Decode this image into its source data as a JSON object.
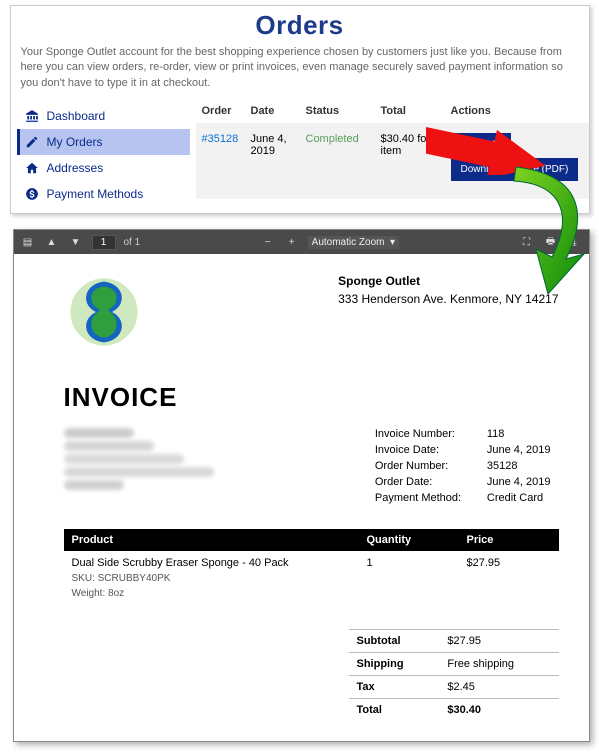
{
  "header": {
    "title": "Orders",
    "description": "Your Sponge Outlet account for the best shopping experience chosen by customers just like you. Because from here you can view orders, re-order, view or print invoices, even manage securely saved payment information so you don't have to type it in at checkout."
  },
  "sidebar": {
    "items": [
      {
        "label": "Dashboard"
      },
      {
        "label": "My Orders"
      },
      {
        "label": "Addresses"
      },
      {
        "label": "Payment Methods"
      }
    ]
  },
  "orders": {
    "columns": {
      "order": "Order",
      "date": "Date",
      "status": "Status",
      "total": "Total",
      "actions": "Actions"
    },
    "row": {
      "order": "#35128",
      "date": "June 4, 2019",
      "status": "Completed",
      "total_line1": "$30.40 for",
      "total_line2": "item",
      "view": "View",
      "download": "Download invoice (PDF)"
    }
  },
  "pdf": {
    "page": "1",
    "pages": "of 1",
    "zoom": "Automatic Zoom"
  },
  "invoice": {
    "company": {
      "name": "Sponge Outlet",
      "address": "333 Henderson Ave. Kenmore, NY 14217"
    },
    "title": "INVOICE",
    "meta": {
      "invoice_number_label": "Invoice Number:",
      "invoice_number": "118",
      "invoice_date_label": "Invoice Date:",
      "invoice_date": "June 4, 2019",
      "order_number_label": "Order Number:",
      "order_number": "35128",
      "order_date_label": "Order Date:",
      "order_date": "June 4, 2019",
      "payment_method_label": "Payment Method:",
      "payment_method": "Credit Card"
    },
    "table": {
      "product_h": "Product",
      "qty_h": "Quantity",
      "price_h": "Price",
      "item": {
        "name": "Dual Side Scrubby Eraser Sponge - 40 Pack",
        "sku_label": "SKU:",
        "sku": "SCRUBBY40PK",
        "weight_label": "Weight:",
        "weight": "8oz",
        "qty": "1",
        "price": "$27.95"
      }
    },
    "totals": {
      "subtotal_l": "Subtotal",
      "subtotal_v": "$27.95",
      "shipping_l": "Shipping",
      "shipping_v": "Free shipping",
      "tax_l": "Tax",
      "tax_v": "$2.45",
      "total_l": "Total",
      "total_v": "$30.40"
    }
  }
}
